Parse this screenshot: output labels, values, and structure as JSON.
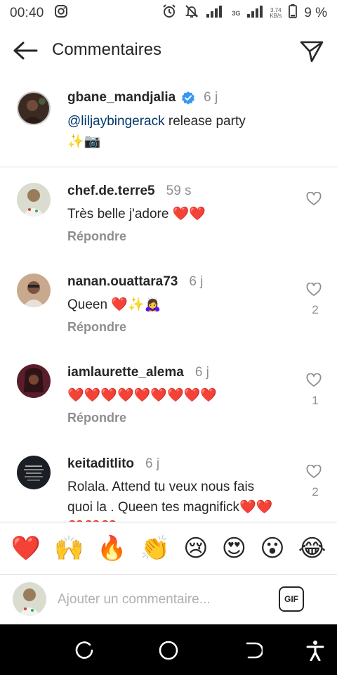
{
  "status_bar": {
    "time": "00:40",
    "network_type": "3G",
    "speed_value": "3.74",
    "speed_unit": "KB/s",
    "battery_percent": "9 %"
  },
  "header": {
    "title": "Commentaires"
  },
  "caption": {
    "username": "gbane_mandjalia",
    "verified": true,
    "time": "6 j",
    "mention": "@liljaybingerack",
    "text": " release party",
    "emojis": "✨📷"
  },
  "comments": [
    {
      "username": "chef.de.terre5",
      "time": "59 s",
      "text": "Très belle j'adore ❤️❤️",
      "reply_label": "Répondre",
      "likes": ""
    },
    {
      "username": "nanan.ouattara73",
      "time": "6 j",
      "text": "Queen ❤️✨🙇‍♀️",
      "reply_label": "Répondre",
      "likes": "2"
    },
    {
      "username": "iamlaurette_alema",
      "time": "6 j",
      "text": "❤️❤️❤️❤️❤️❤️❤️❤️❤️",
      "reply_label": "Répondre",
      "likes": "1"
    },
    {
      "username": "keitaditlito",
      "time": "6 j",
      "text": "Rolala. Attend tu veux nous fais quoi la . Queen tes magnifick❤️❤️❤️❤️❤️",
      "reply_label": "",
      "likes": "2"
    }
  ],
  "emoji_bar": [
    "❤️",
    "🙌",
    "🔥",
    "👏",
    "😢",
    "😍",
    "😮",
    "😂"
  ],
  "composer": {
    "placeholder": "Ajouter un commentaire...",
    "gif_label": "GIF"
  },
  "colors": {
    "text": "#262626",
    "secondary": "#8e8e8e",
    "mention": "#00376b",
    "verified": "#3897f0",
    "divider": "#dbdbdb"
  }
}
